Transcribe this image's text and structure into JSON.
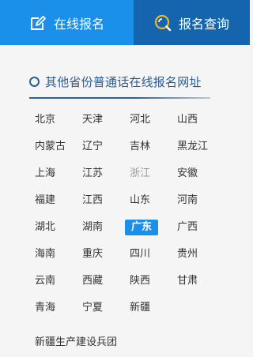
{
  "tabs": [
    {
      "label": "在线报名",
      "icon": "edit-icon"
    },
    {
      "label": "报名查询",
      "icon": "search-icon"
    }
  ],
  "section": {
    "title": "其他省份普通话在线报名网址",
    "icon": "ring-bullet-icon"
  },
  "provinces": [
    {
      "name": "北京",
      "state": "normal"
    },
    {
      "name": "天津",
      "state": "normal"
    },
    {
      "name": "河北",
      "state": "normal"
    },
    {
      "name": "山西",
      "state": "normal"
    },
    {
      "name": "内蒙古",
      "state": "normal"
    },
    {
      "name": "辽宁",
      "state": "normal"
    },
    {
      "name": "吉林",
      "state": "normal"
    },
    {
      "name": "黑龙江",
      "state": "normal"
    },
    {
      "name": "上海",
      "state": "normal"
    },
    {
      "name": "江苏",
      "state": "normal"
    },
    {
      "name": "浙江",
      "state": "disabled"
    },
    {
      "name": "安徽",
      "state": "normal"
    },
    {
      "name": "福建",
      "state": "normal"
    },
    {
      "name": "江西",
      "state": "normal"
    },
    {
      "name": "山东",
      "state": "normal"
    },
    {
      "name": "河南",
      "state": "normal"
    },
    {
      "name": "湖北",
      "state": "normal"
    },
    {
      "name": "湖南",
      "state": "normal"
    },
    {
      "name": "广东",
      "state": "active"
    },
    {
      "name": "广西",
      "state": "normal"
    },
    {
      "name": "海南",
      "state": "normal"
    },
    {
      "name": "重庆",
      "state": "normal"
    },
    {
      "name": "四川",
      "state": "normal"
    },
    {
      "name": "贵州",
      "state": "normal"
    },
    {
      "name": "云南",
      "state": "normal"
    },
    {
      "name": "西藏",
      "state": "normal"
    },
    {
      "name": "陕西",
      "state": "normal"
    },
    {
      "name": "甘肃",
      "state": "normal"
    },
    {
      "name": "青海",
      "state": "normal"
    },
    {
      "name": "宁夏",
      "state": "normal"
    },
    {
      "name": "新疆",
      "state": "normal"
    }
  ],
  "extra_link": "新疆生产建设兵团",
  "colors": {
    "tab_active": "#1a90ea",
    "tab_inactive": "#1465ad",
    "section_accent": "#2f5f93",
    "selected_bg": "#1a90ea"
  }
}
